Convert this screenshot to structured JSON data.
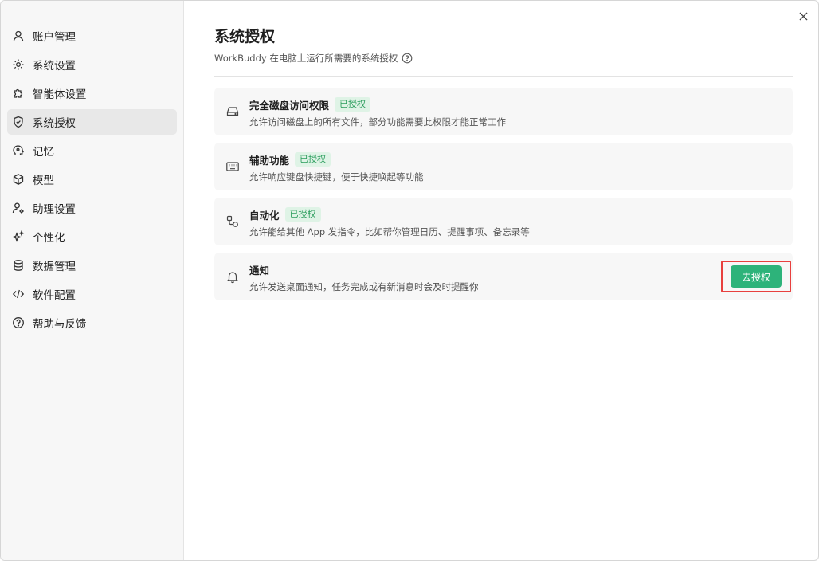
{
  "sidebar": {
    "items": [
      {
        "label": "账户管理",
        "icon": "user-icon"
      },
      {
        "label": "系统设置",
        "icon": "gear-icon"
      },
      {
        "label": "智能体设置",
        "icon": "puzzle-icon"
      },
      {
        "label": "系统授权",
        "icon": "shield-icon",
        "active": true
      },
      {
        "label": "记忆",
        "icon": "brain-head-icon"
      },
      {
        "label": "模型",
        "icon": "cube-icon"
      },
      {
        "label": "助理设置",
        "icon": "user-gear-icon"
      },
      {
        "label": "个性化",
        "icon": "sparkle-icon"
      },
      {
        "label": "数据管理",
        "icon": "database-icon"
      },
      {
        "label": "软件配置",
        "icon": "code-icon"
      },
      {
        "label": "帮助与反馈",
        "icon": "help-circle-icon"
      }
    ]
  },
  "main": {
    "title": "系统授权",
    "subtitle": "WorkBuddy 在电脑上运行所需要的系统授权",
    "permissions": [
      {
        "title": "完全磁盘访问权限",
        "badge": "已授权",
        "desc": "允许访问磁盘上的所有文件，部分功能需要此权限才能正常工作",
        "icon": "hard-drive-icon"
      },
      {
        "title": "辅助功能",
        "badge": "已授权",
        "desc": "允许响应键盘快捷键，便于快捷唤起等功能",
        "icon": "keyboard-icon"
      },
      {
        "title": "自动化",
        "badge": "已授权",
        "desc": "允许能给其他 App 发指令，比如帮你管理日历、提醒事项、备忘录等",
        "icon": "automation-icon"
      },
      {
        "title": "通知",
        "desc": "允许发送桌面通知，任务完成或有新消息时会及时提醒你",
        "icon": "bell-icon",
        "action": "去授权"
      }
    ]
  },
  "colors": {
    "accent": "#2db37a",
    "badge_text": "#2a9d5c",
    "badge_bg": "#dff3e6",
    "highlight": "#e8403e"
  }
}
